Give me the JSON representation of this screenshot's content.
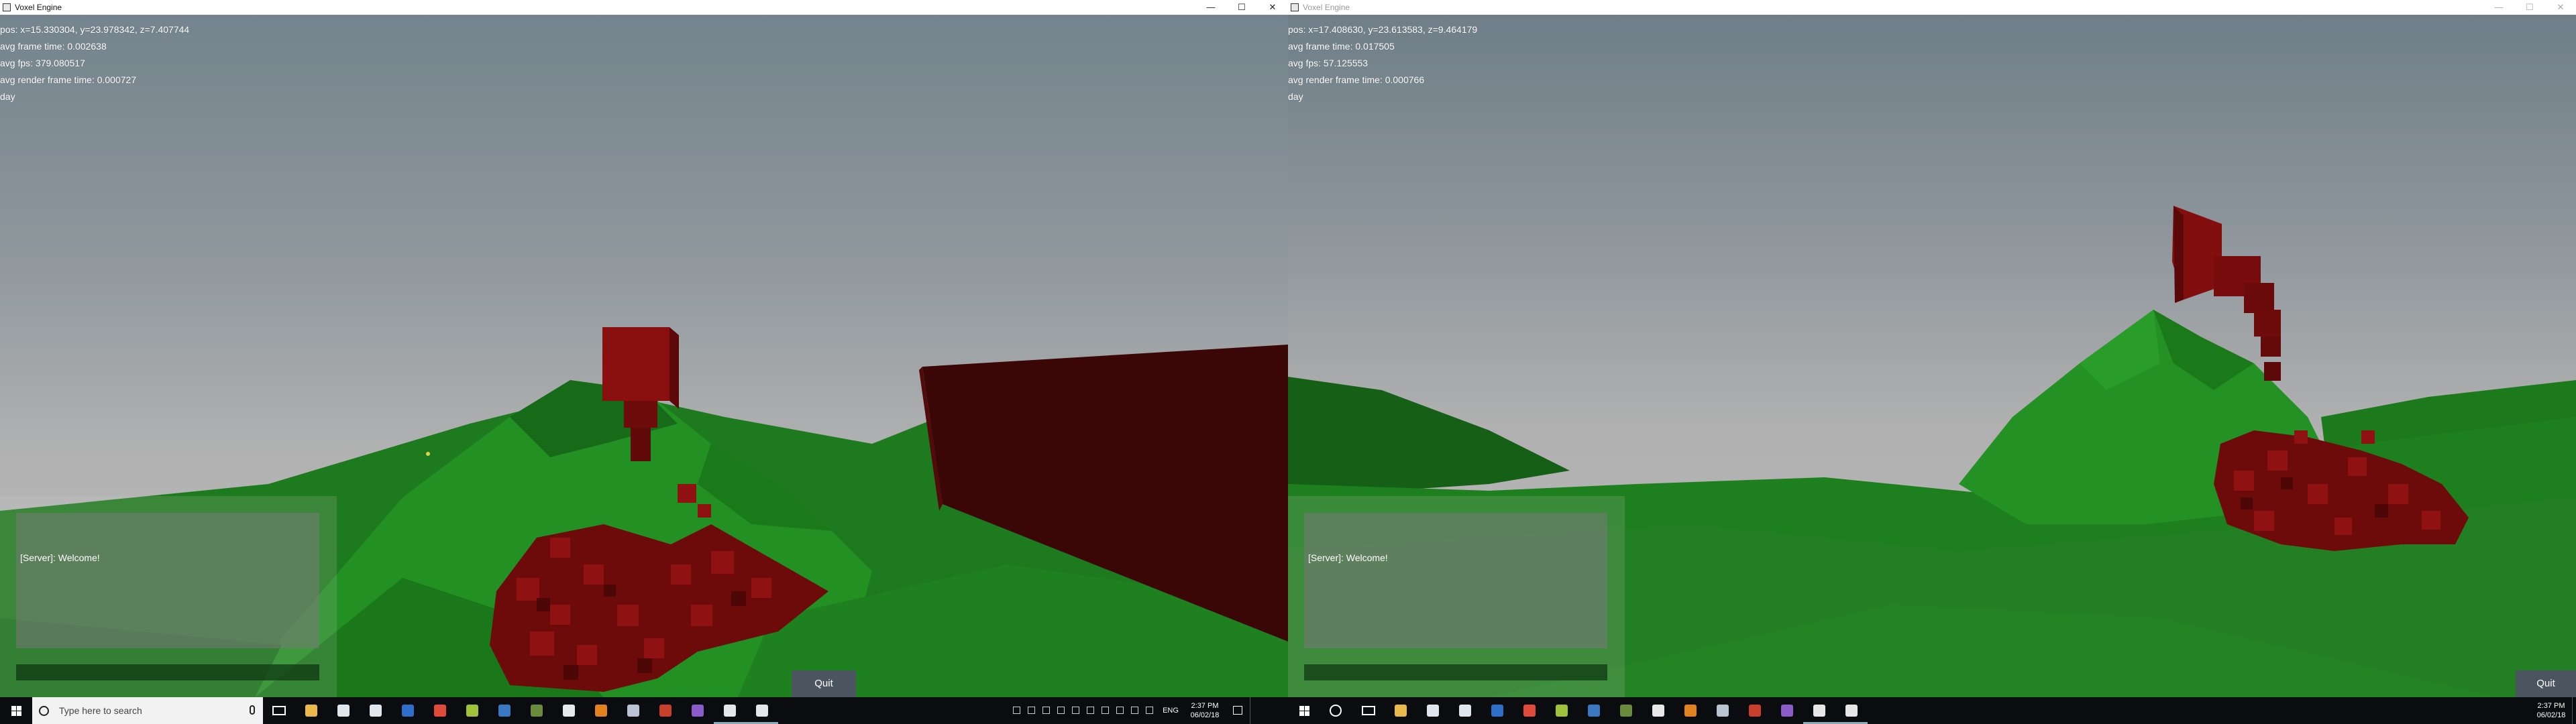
{
  "windows": [
    {
      "title": "Voxel Engine",
      "controls": {
        "minimize": "—",
        "maximize": "☐",
        "close": "✕"
      },
      "hud": {
        "pos": "pos: x=15.330304, y=23.978342, z=7.407744",
        "frame_time": "avg frame time: 0.002638",
        "fps": "avg fps: 379.080517",
        "render_time": "avg render frame time: 0.000727",
        "time_of_day": "day"
      },
      "chat": {
        "message": "[Server]: Welcome!",
        "input_value": ""
      },
      "quit_label": "Quit"
    },
    {
      "title": "Voxel Engine",
      "controls": {
        "minimize": "—",
        "maximize": "☐",
        "close": "✕"
      },
      "hud": {
        "pos": "pos: x=17.408630, y=23.613583, z=9.464179",
        "frame_time": "avg frame time: 0.017505",
        "fps": "avg fps: 57.125553",
        "render_time": "avg render frame time: 0.000766",
        "time_of_day": "day"
      },
      "chat": {
        "message": "[Server]: Welcome!",
        "input_value": ""
      },
      "quit_label": "Quit"
    }
  ],
  "taskbar_left": {
    "search_placeholder": "Type here to search",
    "apps": [
      {
        "icon": "file-explorer-icon",
        "color": "#e8b84a"
      },
      {
        "icon": "cloud-app-icon",
        "color": "#dfe6ee"
      },
      {
        "icon": "onedrive-icon",
        "color": "#dfe6ee"
      },
      {
        "icon": "remote-desktop-icon",
        "color": "#2d6fc9"
      },
      {
        "icon": "chrome-icon",
        "color": "#e04a3a"
      },
      {
        "icon": "android-studio-icon",
        "color": "#9fc23a"
      },
      {
        "icon": "steam-icon",
        "color": "#3a78c2"
      },
      {
        "icon": "minecraft-icon",
        "color": "#6a8a3c"
      },
      {
        "icon": "mail-icon",
        "color": "#e8e8e8"
      },
      {
        "icon": "search-app-icon",
        "color": "#e2821e"
      },
      {
        "icon": "settings-tool-icon",
        "color": "#b9c4d0"
      },
      {
        "icon": "game-icon",
        "color": "#c8402c"
      },
      {
        "icon": "visual-studio-icon",
        "color": "#8a5dc8"
      },
      {
        "icon": "voxel-engine-icon",
        "color": "#e6e6e6",
        "active": true
      },
      {
        "icon": "voxel-engine-icon",
        "color": "#e6e6e6",
        "active": true
      }
    ],
    "tray": {
      "language": "ENG",
      "time": "2:37 PM",
      "date": "06/02/18"
    }
  },
  "taskbar_right": {
    "apps": [
      {
        "icon": "file-explorer-icon",
        "color": "#e8b84a"
      },
      {
        "icon": "cloud-app-icon",
        "color": "#dfe6ee"
      },
      {
        "icon": "onedrive-icon",
        "color": "#dfe6ee"
      },
      {
        "icon": "remote-desktop-icon",
        "color": "#2d6fc9"
      },
      {
        "icon": "chrome-icon",
        "color": "#e04a3a"
      },
      {
        "icon": "android-studio-icon",
        "color": "#9fc23a"
      },
      {
        "icon": "steam-icon",
        "color": "#3a78c2"
      },
      {
        "icon": "minecraft-icon",
        "color": "#6a8a3c"
      },
      {
        "icon": "mail-icon",
        "color": "#e8e8e8"
      },
      {
        "icon": "search-app-icon",
        "color": "#e2821e"
      },
      {
        "icon": "settings-tool-icon",
        "color": "#b9c4d0"
      },
      {
        "icon": "game-icon",
        "color": "#c8402c"
      },
      {
        "icon": "visual-studio-icon",
        "color": "#8a5dc8"
      },
      {
        "icon": "voxel-engine-icon",
        "color": "#e6e6e6",
        "active": true
      },
      {
        "icon": "voxel-engine-icon",
        "color": "#e6e6e6",
        "active": true
      }
    ],
    "tray": {
      "time": "2:37 PM",
      "date": "06/02/18"
    }
  },
  "colors": {
    "sky_top": "#74838d",
    "sky_bottom": "#b4b4b4",
    "grass": "#1c7d1c",
    "grass_dark": "#0f5010",
    "voxel_red": "#7a0c0c",
    "voxel_dark": "#3a0606"
  }
}
